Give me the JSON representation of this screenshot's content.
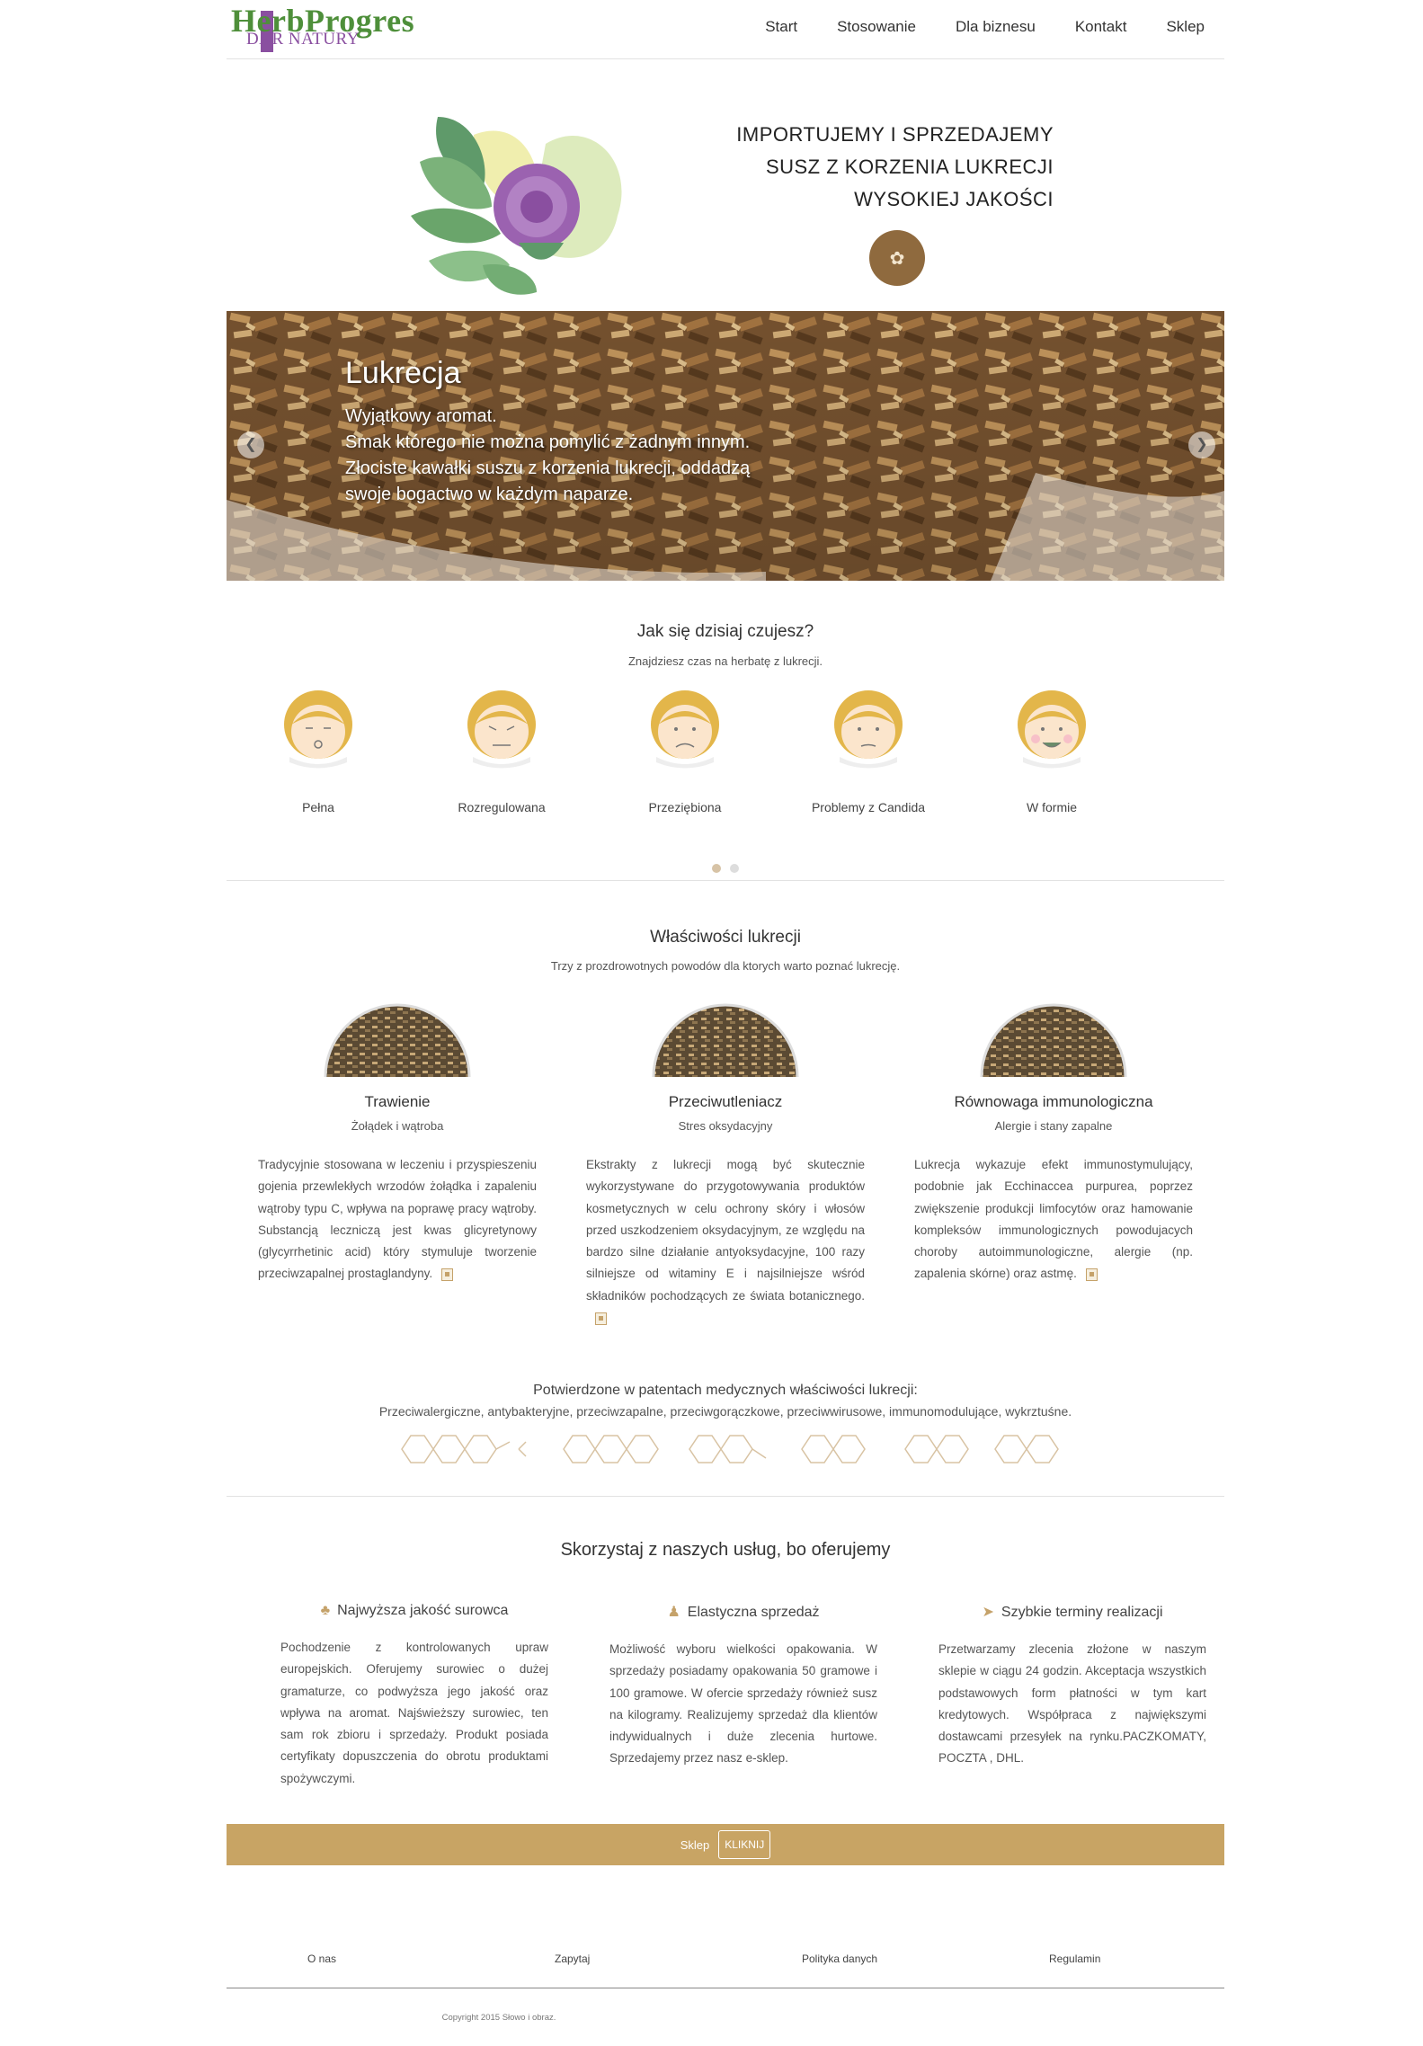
{
  "brand": {
    "name": "HerbProgres",
    "tagline": "DAR NATURY",
    "green": "#4e8f3a",
    "purple": "#8a4fa0",
    "gold": "#c8a464"
  },
  "nav": {
    "items": [
      "Start",
      "Stosowanie",
      "Dla biznesu",
      "Kontakt",
      "Sklep"
    ]
  },
  "hero": {
    "lines": [
      "IMPORTUJEMY I SPRZEDAJEMY",
      "SUSZ Z KORZENIA LUKRECJI",
      "WYSOKIEJ JAKOŚCI"
    ],
    "art_icon": "flower-leaves-illustration",
    "seal_icon": "quality-seal-icon"
  },
  "slider": {
    "title": "Lukrecja",
    "lines": [
      "Wyjątkowy aromat.",
      "Smak którego nie można pomylić z żadnym innym.",
      "Złociste kawałki suszu z korzenia lukrecji, oddadzą",
      "swoje bogactwo w każdym naparze."
    ],
    "prev_icon": "chevron-left-icon",
    "next_icon": "chevron-right-icon"
  },
  "feelings": {
    "title": "Jak się dzisiaj czujesz?",
    "subtitle": "Znajdziesz czas na herbatę z lukrecji.",
    "items": [
      {
        "label": "Pełna"
      },
      {
        "label": "Rozregulowana"
      },
      {
        "label": "Przeziębiona"
      },
      {
        "label": "Problemy z Candida"
      },
      {
        "label": "W formie"
      }
    ],
    "pages": 2,
    "active_page": 1
  },
  "properties": {
    "title": "Właściwości lukrecji",
    "subtitle": "Trzy z prozdrowotnych powodów dla ktorych warto poznać lukrecję.",
    "items": [
      {
        "title": "Trawienie",
        "subtitle": "Żołądek i wątroba",
        "text": "Tradycyjnie stosowana w leczeniu i przyspieszeniu gojenia przewlekłych wrzodów żołądka i zapaleniu wątroby typu C, wpływa na poprawę pracy wątroby. Substancją leczniczą jest kwas glicyretynowy (glycyrrhetinic acid) który stymuluje tworzenie przeciwzapalnej prostaglandyny."
      },
      {
        "title": "Przeciwutleniacz",
        "subtitle": "Stres oksydacyjny",
        "text": "Ekstrakty z lukrecji mogą być skutecznie wykorzystywane do przygotowywania produktów kosmetycznych w celu ochrony skóry i włosów przed uszkodzeniem oksydacyjnym, ze względu na bardzo silne działanie antyoksydacyjne, 100 razy silniejsze od witaminy E i najsilniejsze wśród składników pochodzących ze świata botanicznego."
      },
      {
        "title": "Równowaga immunologiczna",
        "subtitle": "Alergie i stany zapalne",
        "text": "Lukrecja wykazuje efekt immunostymulujący, podobnie jak Ecchinaccea purpurea, poprzez zwiększenie produkcji limfocytów oraz hamowanie kompleksów immunologicznych powodujacych choroby autoimmunologiczne, alergie (np. zapalenia skórne) oraz astmę."
      }
    ]
  },
  "patents": {
    "title": "Potwierdzone w patentach medycznych właściwości lukrecji:",
    "list": "Przeciwalergiczne, antybakteryjne, przeciwzapalne, przeciwgorączkowe, przeciwwirusowe, immunomodulujące, wykrztuśne."
  },
  "services": {
    "title": "Skorzystaj z naszych usług, bo oferujemy",
    "items": [
      {
        "icon": "tree-icon",
        "glyph": "♣",
        "title": "Najwyższa jakość surowca",
        "text": "Pochodzenie z kontrolowanych upraw europejskich. Oferujemy surowiec o dużej gramaturze, co podwyższa jego jakość oraz wpływa na aromat. Najświeższy surowiec, ten sam rok zbioru i sprzedaży. Produkt posiada certyfikaty dopuszczenia do obrotu produktami spożywczymi."
      },
      {
        "icon": "person-icon",
        "glyph": "♟",
        "title": "Elastyczna sprzedaż",
        "text": "Możliwość wyboru wielkości opakowania. W sprzedaży posiadamy opakowania 50 gramowe i 100 gramowe. W ofercie sprzedaży również susz na kilogramy. Realizujemy sprzedaż dla klientów indywidualnych i duże zlecenia hurtowe. Sprzedajemy przez nasz e-sklep."
      },
      {
        "icon": "send-arrow-icon",
        "glyph": "➤",
        "title": "Szybkie terminy realizacji",
        "text": "Przetwarzamy zlecenia złożone w naszym sklepie w ciągu 24 godzin. Akceptacja wszystkich podstawowych form płatności w tym kart kredytowych. Współpraca z największymi dostawcami przesyłek na rynku.PACZKOMATY, POCZTA , DHL."
      }
    ]
  },
  "shop": {
    "label": "Sklep",
    "button": "KLIKNIJ"
  },
  "footer": {
    "links": [
      "O nas",
      "Zapytaj",
      "Polityka danych",
      "Regulamin"
    ],
    "copyright": "Copyright 2015 Słowo i obraz."
  }
}
